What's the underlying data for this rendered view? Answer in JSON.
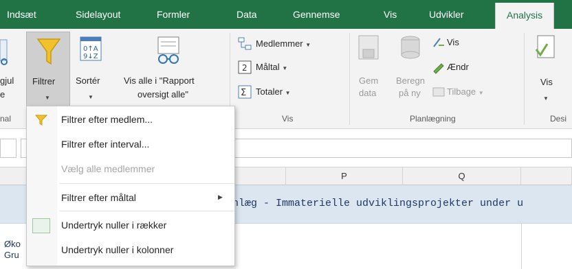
{
  "tabs": [
    "Indsæt",
    "Sidelayout",
    "Formler",
    "Data",
    "Gennemse",
    "Vis",
    "Udvikler",
    "Analysis"
  ],
  "ribbon": {
    "partial_left_line1": "gjul",
    "partial_left_line2": "e",
    "partial_left_group": "nal",
    "filter_label": "Filtrer",
    "sort_label": "Sortér",
    "show_all_line1": "Vis alle i \"Rapport",
    "show_all_line2": "oversigt alle\"",
    "members_label": "Medlemmer",
    "measures_label": "Måltal",
    "totals_label": "Totaler",
    "vis_group": "Vis",
    "save_data_line1": "Gem",
    "save_data_line2": "data",
    "recalc_line1": "Beregn",
    "recalc_line2": "på ny",
    "show_label": "Vis",
    "change_label": "Ændr",
    "back_label": "Tilbage",
    "planning_group": "Planlægning",
    "design_vis_label": "Vis",
    "design_group": "Desi"
  },
  "menu": {
    "items": [
      {
        "label": "Filtrer efter medlem...",
        "disabled": false,
        "icon": "filter-icon"
      },
      {
        "label": "Filtrer efter interval...",
        "disabled": false,
        "icon": ""
      },
      {
        "label": "Vælg alle medlemmer",
        "disabled": true,
        "icon": ""
      },
      {
        "label": "Filtrer efter måltal",
        "disabled": false,
        "icon": "",
        "submenu": true
      },
      {
        "label": "Undertryk nuller i rækker",
        "disabled": false,
        "icon": "checkbox-icon"
      },
      {
        "label": "Undertryk nuller i kolonner",
        "disabled": false,
        "icon": ""
      }
    ]
  },
  "grid": {
    "col_p": "P",
    "col_q": "Q",
    "banner_text": "nlæg - Immaterielle udviklingsprojekter under u",
    "row2_line1": "Øko",
    "row2_line2": "Gru"
  },
  "colors": {
    "accent": "#217346",
    "highlight": "#dce6f1",
    "filter_yellow": "#f2c12e"
  }
}
